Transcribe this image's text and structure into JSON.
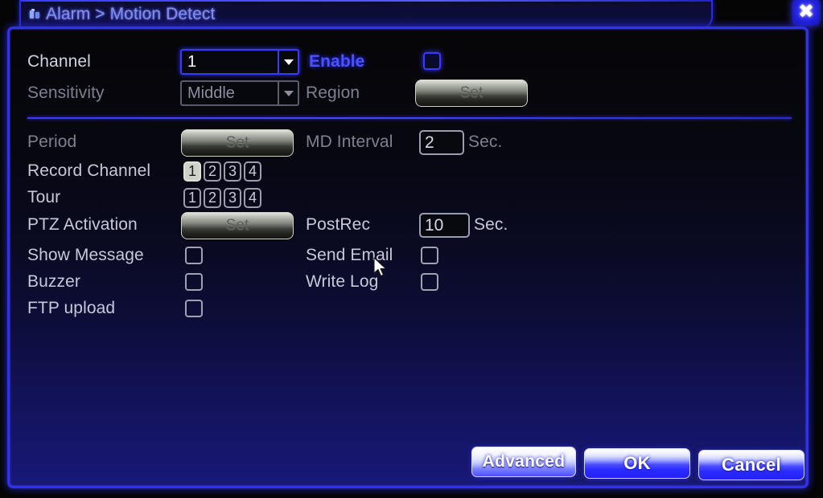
{
  "window": {
    "title": "Alarm > Motion Detect",
    "alarm_icon": "alarm-icon",
    "close_icon": "✖"
  },
  "top_section": {
    "channel_label": "Channel",
    "channel_value": "1",
    "enable_label": "Enable",
    "enable_checked": false,
    "sensitivity_label": "Sensitivity",
    "sensitivity_value": "Middle",
    "region_label": "Region",
    "region_button": "Set"
  },
  "main_section": {
    "period_label": "Period",
    "period_button": "Set",
    "md_interval_label": "MD Interval",
    "md_interval_value": "2",
    "md_interval_unit": "Sec.",
    "record_channel_label": "Record Channel",
    "record_channel_options": [
      "1",
      "2",
      "3",
      "4"
    ],
    "record_channel_selected": "1",
    "tour_label": "Tour",
    "tour_options": [
      "1",
      "2",
      "3",
      "4"
    ],
    "ptz_activation_label": "PTZ Activation",
    "ptz_activation_button": "Set",
    "postrec_label": "PostRec",
    "postrec_value": "10",
    "postrec_unit": "Sec.",
    "show_message_label": "Show Message",
    "send_email_label": "Send Email",
    "buzzer_label": "Buzzer",
    "write_log_label": "Write Log",
    "ftp_upload_label": "FTP upload"
  },
  "footer": {
    "advanced_label": "Advanced",
    "ok_label": "OK",
    "cancel_label": "Cancel"
  },
  "colors": {
    "accent_blue": "#3030f0",
    "highlight_blue": "#4a52ff",
    "disabled_gray": "#7d8090",
    "text_gray": "#c6c9d8"
  }
}
